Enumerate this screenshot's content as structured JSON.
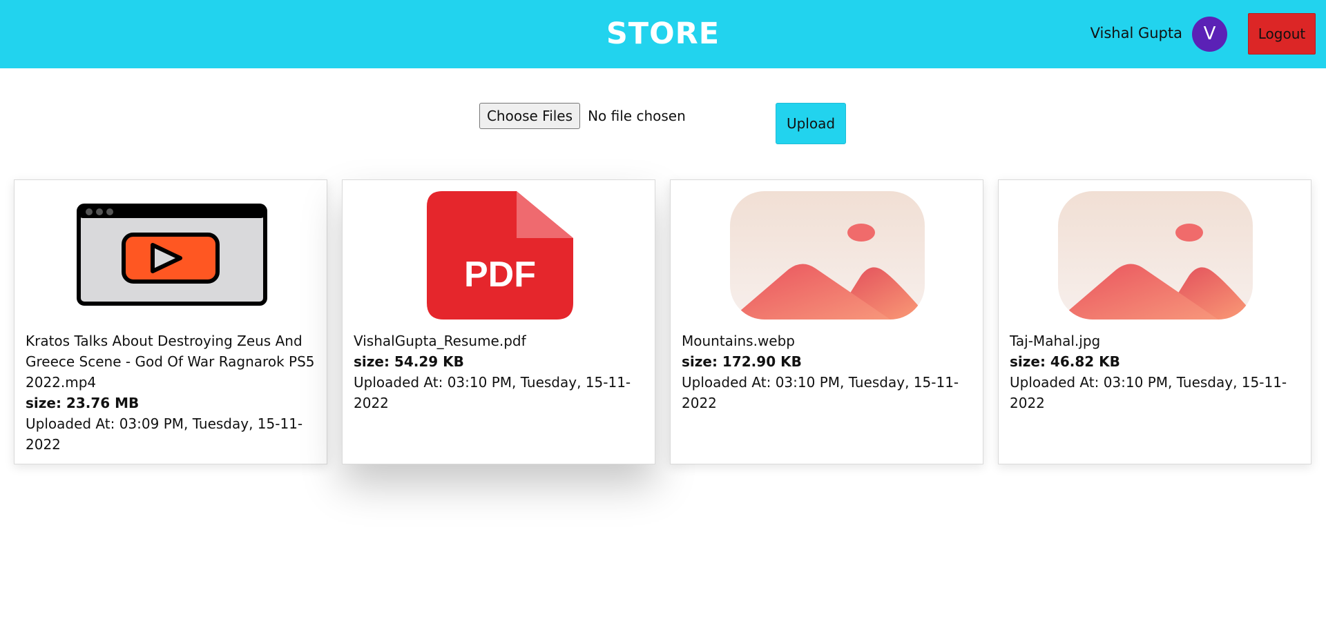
{
  "header": {
    "brand": "STORE",
    "user_name": "Vishal Gupta",
    "avatar_initial": "V",
    "logout_label": "Logout"
  },
  "upload": {
    "choose_label": "Choose Files",
    "status_text": "No file chosen",
    "upload_label": "Upload"
  },
  "files": [
    {
      "name": "Kratos Talks About Destroying Zeus And Greece Scene - God Of War Ragnarok PS5 2022.mp4",
      "size": "size: 23.76 MB",
      "uploaded": "Uploaded At: 03:09 PM, Tuesday, 15-11-2022",
      "icon": "video-icon"
    },
    {
      "name": "VishalGupta_Resume.pdf",
      "size": "size: 54.29 KB",
      "uploaded": "Uploaded At: 03:10 PM, Tuesday, 15-11-2022",
      "icon": "pdf-icon",
      "icon_text": "PDF"
    },
    {
      "name": "Mountains.webp",
      "size": "size: 172.90 KB",
      "uploaded": "Uploaded At: 03:10 PM, Tuesday, 15-11-2022",
      "icon": "image-icon"
    },
    {
      "name": "Taj-Mahal.jpg",
      "size": "size: 46.82 KB",
      "uploaded": "Uploaded At: 03:10 PM, Tuesday, 15-11-2022",
      "icon": "image-icon"
    }
  ],
  "colors": {
    "header_bg": "#22d3ee",
    "avatar_bg": "#5b21b6",
    "logout_bg": "#dc2626",
    "pdf_red": "#e5262c"
  }
}
